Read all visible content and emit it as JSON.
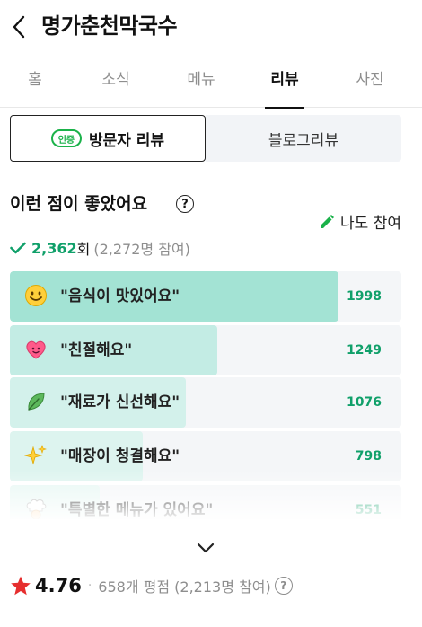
{
  "header": {
    "title": "명가춘천막국수",
    "back_icon": "chevron-left-icon"
  },
  "tabs": [
    {
      "label": "홈",
      "active": false
    },
    {
      "label": "소식",
      "active": false
    },
    {
      "label": "메뉴",
      "active": false
    },
    {
      "label": "리뷰",
      "active": true
    },
    {
      "label": "사진",
      "active": false
    }
  ],
  "review_type": {
    "visitor": {
      "badge": "인증",
      "label": "방문자 리뷰",
      "selected": true
    },
    "blog": {
      "label": "블로그리뷰",
      "selected": false
    }
  },
  "keywords_section": {
    "title": "이런 점이 좋았어요",
    "help_icon": "question-circle-icon",
    "help_glyph": "?",
    "join_label": "나도 참여",
    "join_icon": "pencil-icon",
    "total_count": "2,362",
    "total_unit": "회",
    "participants": "(2,272명 참여)",
    "check_icon": "check-icon"
  },
  "keywords": [
    {
      "emoji": "smiling-face-icon",
      "label": "\"음식이 맛있어요\"",
      "count": "1998",
      "ratio": 0.84,
      "fill": "#a3e3d4"
    },
    {
      "emoji": "heart-face-icon",
      "label": "\"친절해요\"",
      "count": "1249",
      "ratio": 0.53,
      "fill": "#c3ece4"
    },
    {
      "emoji": "leaf-icon",
      "label": "\"재료가 신선해요\"",
      "count": "1076",
      "ratio": 0.45,
      "fill": "#d3f1eb"
    },
    {
      "emoji": "sparkles-icon",
      "label": "\"매장이 청결해요\"",
      "count": "798",
      "ratio": 0.34,
      "fill": "#ddf4ef"
    },
    {
      "emoji": "chef-icon",
      "label": "\"특별한 메뉴가 있어요\"",
      "count": "551",
      "ratio": 0.23,
      "fill": "#e6f7f3"
    }
  ],
  "expand_icon": "chevron-down-icon",
  "rating": {
    "star_icon": "star-icon",
    "value": "4.76",
    "separator": "·",
    "reviews": "658개 평점 (2,213명 참여)",
    "help_glyph": "?"
  },
  "colors": {
    "accent_green": "#10a06a",
    "star_red": "#e62e2e",
    "badge_green": "#1bb24a"
  }
}
